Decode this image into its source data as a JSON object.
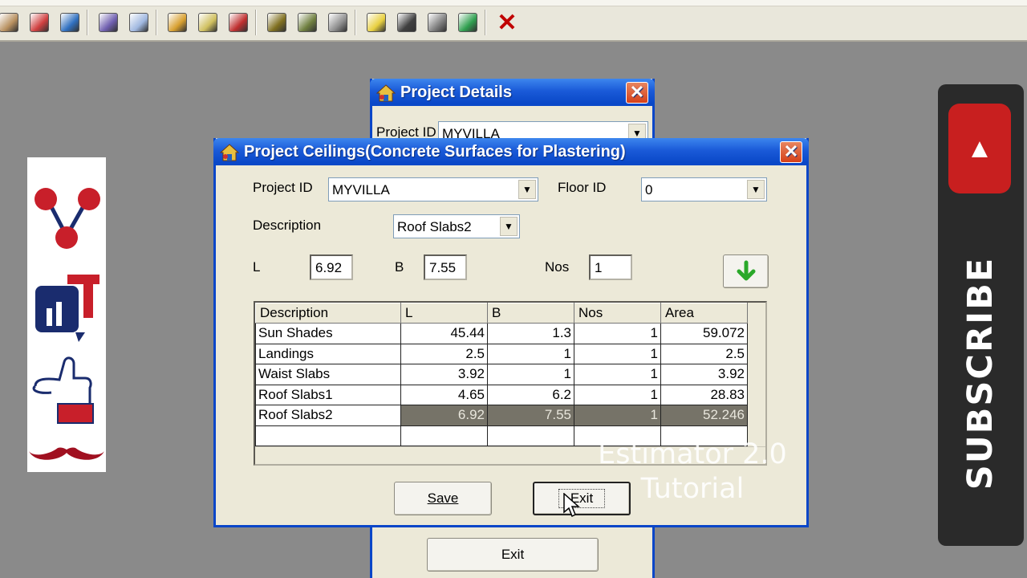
{
  "toolbar": {
    "icons": [
      "tools-icon",
      "package-icon",
      "edit-document-icon",
      "books-icon",
      "notepad-icon",
      "notebook-icon",
      "search-document-icon",
      "report-icon",
      "box-icon",
      "brush-icon",
      "weights-icon",
      "lightbulb-icon",
      "camera-icon",
      "stack-icon",
      "globe-icon"
    ],
    "close_label": "✕"
  },
  "project_details": {
    "title": "Project Details",
    "project_id_label": "Project ID",
    "project_id_value": "MYVILLA",
    "exit_label": "Exit"
  },
  "ceilings": {
    "title": "Project Ceilings(Concrete Surfaces for Plastering)",
    "project_id_label": "Project ID",
    "project_id_value": "MYVILLA",
    "floor_id_label": "Floor ID",
    "floor_id_value": "0",
    "description_label": "Description",
    "description_value": "Roof Slabs2",
    "l_label": "L",
    "l_value": "6.92",
    "b_label": "B",
    "b_value": "7.55",
    "nos_label": "Nos",
    "nos_value": "1",
    "columns": [
      "Description",
      "L",
      "B",
      "Nos",
      "Area"
    ],
    "rows": [
      [
        "Sun Shades",
        "45.44",
        "1.3",
        "1",
        "59.072"
      ],
      [
        "Landings",
        "2.5",
        "1",
        "1",
        "2.5"
      ],
      [
        "Waist Slabs",
        "3.92",
        "1",
        "1",
        "3.92"
      ],
      [
        "Roof Slabs1",
        "4.65",
        "6.2",
        "1",
        "28.83"
      ],
      [
        "Roof Slabs2",
        "6.92",
        "7.55",
        "1",
        "52.246"
      ],
      [
        "",
        "",
        "",
        "",
        ""
      ]
    ],
    "selected_row": 4,
    "save_label": "Save",
    "exit_label": "Exit"
  },
  "overlay": {
    "watermark_line1": "Estimator 2.0",
    "watermark_line2": "Tutorial",
    "subscribe_label": "SUBSCRIBE"
  },
  "colors": {
    "title_blue": "#0a48c8",
    "close_red": "#d64019",
    "brand_red": "#c81f1f",
    "brand_navy": "#1a2c6e"
  }
}
